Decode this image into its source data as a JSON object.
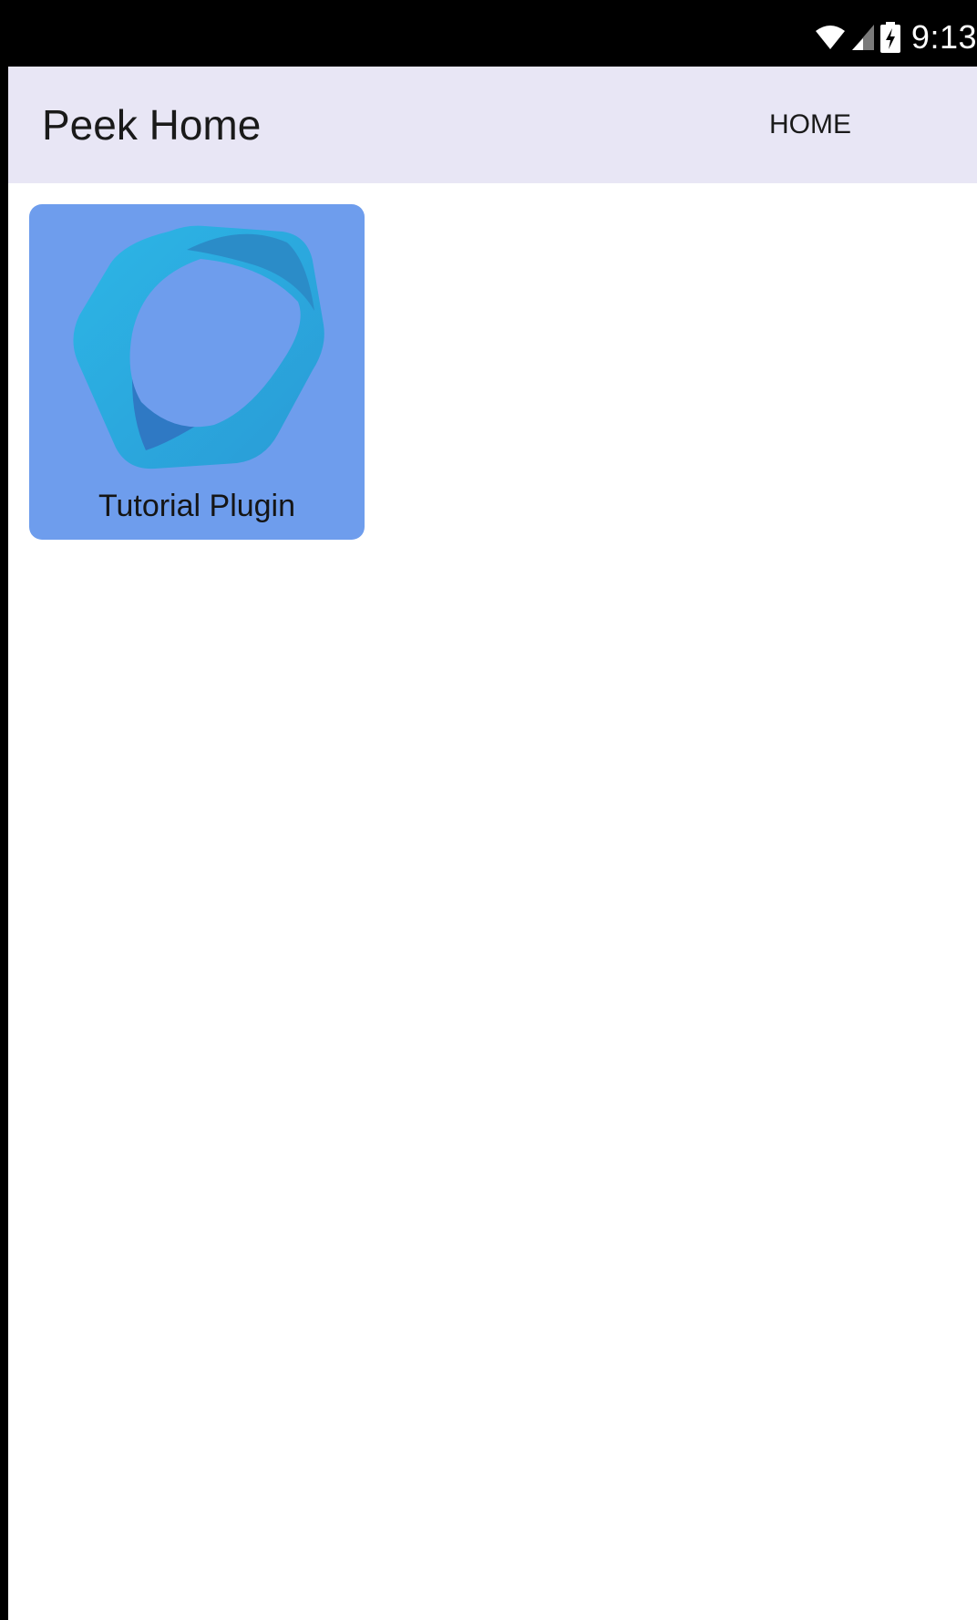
{
  "status_bar": {
    "time": "9:13",
    "icons": [
      "wifi-icon",
      "cell-signal-icon",
      "battery-charging-icon"
    ]
  },
  "toolbar": {
    "title": "Peek Home",
    "action_label": "HOME",
    "background": "#e8e6f5"
  },
  "plugins": [
    {
      "label": "Tutorial Plugin",
      "icon": "tutorial-plugin-logo-icon",
      "tile_color": "#6e9ded"
    }
  ]
}
